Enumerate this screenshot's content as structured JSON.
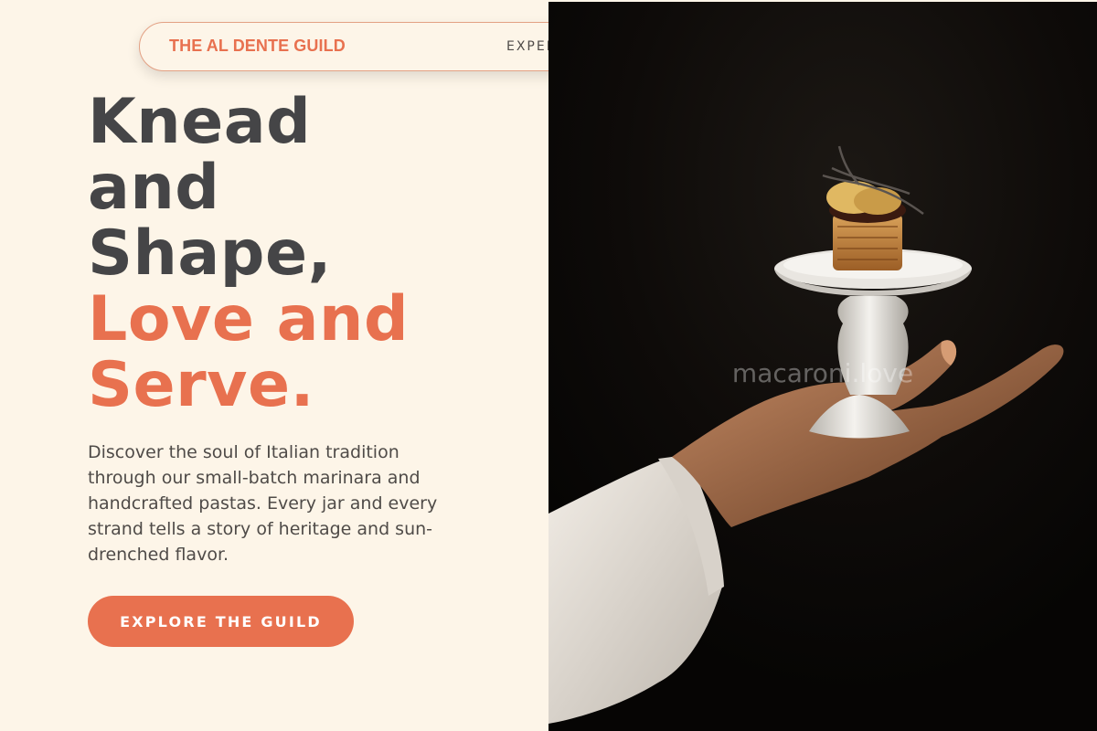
{
  "nav": {
    "brand": "THE AL DENTE GUILD",
    "link": "EXPER"
  },
  "hero": {
    "headline_dark": [
      "Knead",
      "and",
      "Shape,"
    ],
    "headline_accent": [
      "Love and",
      "Serve."
    ],
    "description": "Discover the soul of Italian tradition through our small-batch marinara and handcrafted pastas. Every jar and every strand tells a story of heritage and sun-drenched flavor.",
    "cta_label": "EXPLORE THE GUILD"
  },
  "photo": {
    "watermark": "macaroni.love"
  },
  "colors": {
    "background": "#fdf5e8",
    "accent": "#e8714f",
    "headline_dark": "#454547",
    "body_text": "#4f4b48"
  }
}
